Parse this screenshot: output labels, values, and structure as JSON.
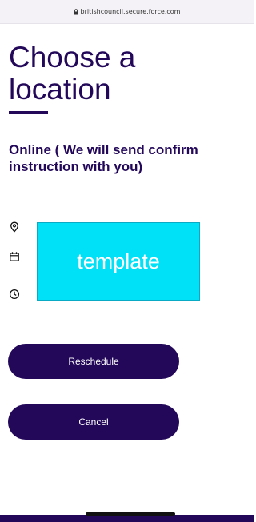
{
  "browser": {
    "url": "britishcouncil.secure.force.com",
    "lock_icon": "lock-icon"
  },
  "page": {
    "title": "Choose a location",
    "title_line1": "Choose a",
    "title_line2": "location",
    "subheading": "Online ( We will send confirm instruction with you)"
  },
  "details": {
    "icons": [
      "location-pin-icon",
      "calendar-icon",
      "clock-icon"
    ],
    "template_label": "template",
    "template_color": "#00e0f7"
  },
  "actions": {
    "reschedule_label": "Reschedule",
    "cancel_label": "Cancel"
  },
  "colors": {
    "brand": "#23085a",
    "button_text": "#ffffff"
  }
}
